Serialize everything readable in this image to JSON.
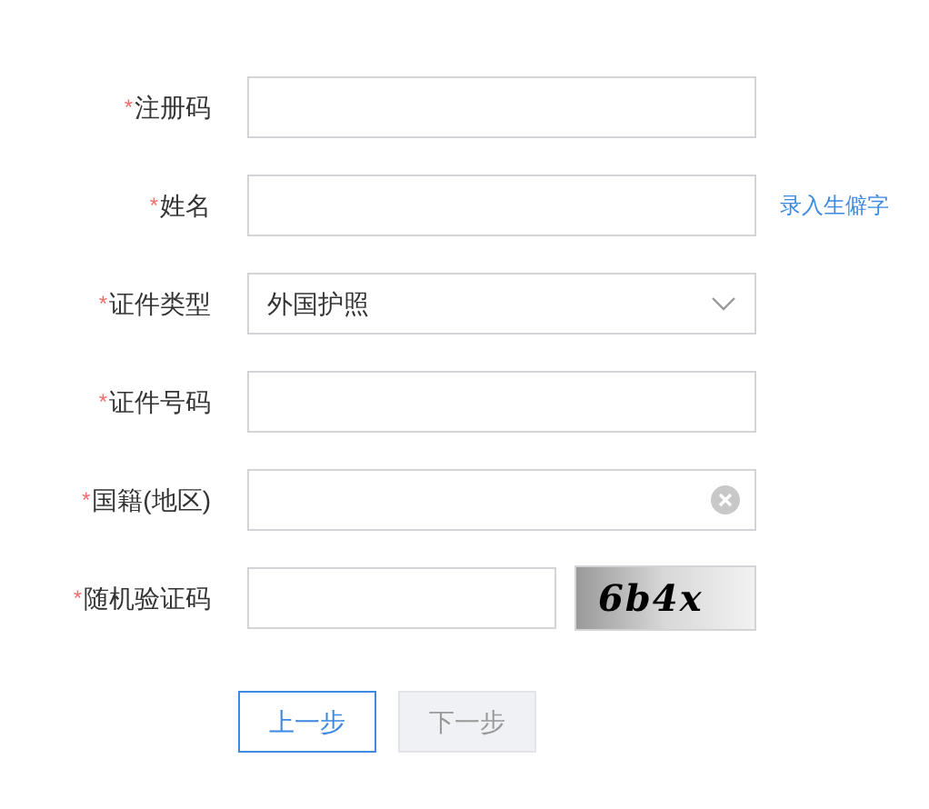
{
  "form": {
    "fields": [
      {
        "kind": "text",
        "asterisk": "*",
        "label": "注册码"
      },
      {
        "kind": "text",
        "asterisk": "*",
        "label": "姓名",
        "link": "录入生僻字"
      },
      {
        "kind": "select",
        "asterisk": "*",
        "label": "证件类型",
        "value": "外国护照"
      },
      {
        "kind": "text",
        "asterisk": "*",
        "label": "证件号码"
      },
      {
        "kind": "clearable",
        "asterisk": "*",
        "label": "国籍(地区)"
      },
      {
        "kind": "captcha",
        "asterisk": "*",
        "label": "随机验证码",
        "captcha": "6b4x"
      }
    ]
  },
  "buttons": [
    {
      "label": "上一步",
      "disabled": false
    },
    {
      "label": "下一步",
      "disabled": true
    }
  ]
}
